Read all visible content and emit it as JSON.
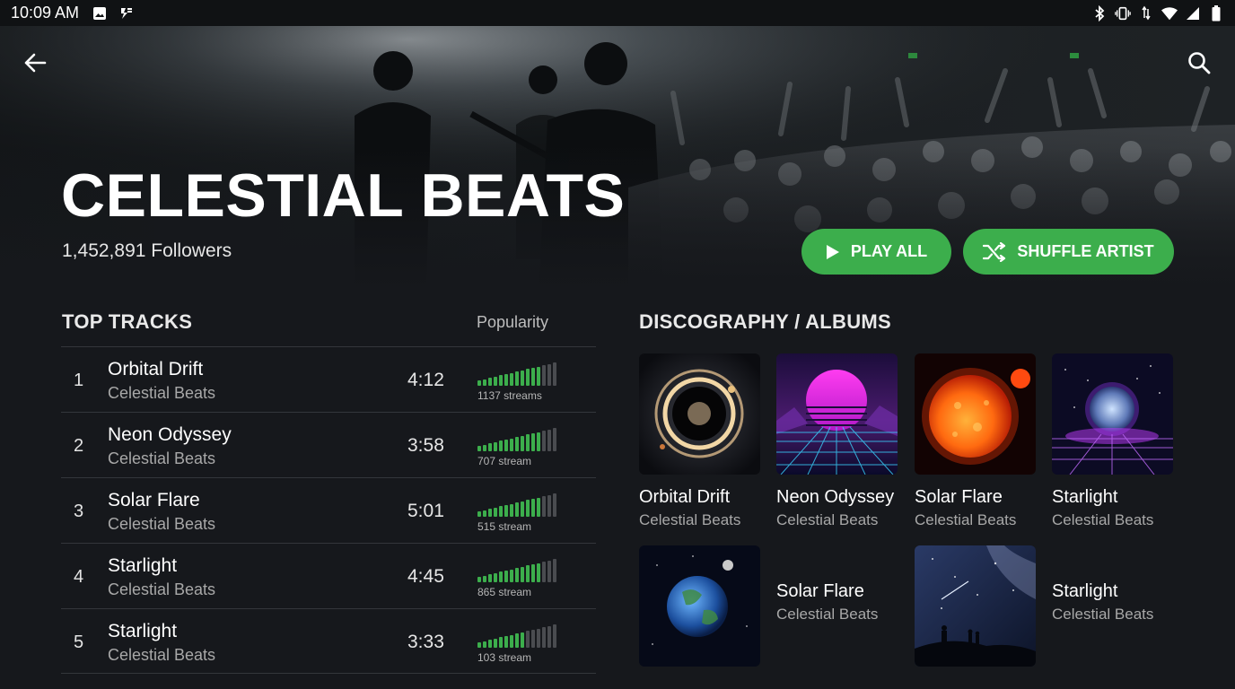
{
  "status_bar": {
    "time": "10:09 AM"
  },
  "artist": {
    "name": "CELESTIAL BEATS",
    "followers": "1,452,891 Followers"
  },
  "actions": {
    "play_all": "PLAY ALL",
    "shuffle": "SHUFFLE ARTIST"
  },
  "top_tracks": {
    "title": "TOP TRACKS",
    "popularity_label": "Popularity",
    "items": [
      {
        "number": "1",
        "title": "Orbital Drift",
        "artist": "Celestial Beats",
        "duration": "4:12",
        "streams": "1137 streams",
        "popularity": 0.8
      },
      {
        "number": "2",
        "title": "Neon Odyssey",
        "artist": "Celestial Beats",
        "duration": "3:58",
        "streams": "707 stream",
        "popularity": 0.8
      },
      {
        "number": "3",
        "title": "Solar Flare",
        "artist": "Celestial Beats",
        "duration": "5:01",
        "streams": "515 stream",
        "popularity": 0.8
      },
      {
        "number": "4",
        "title": "Starlight",
        "artist": "Celestial Beats",
        "duration": "4:45",
        "streams": "865 stream",
        "popularity": 0.8
      },
      {
        "number": "5",
        "title": "Starlight",
        "artist": "Celestial Beats",
        "duration": "3:33",
        "streams": "103 stream",
        "popularity": 0.6
      }
    ]
  },
  "discography": {
    "title": "DISCOGRAPHY / ALBUMS",
    "albums": [
      {
        "title": "Orbital Drift",
        "artist": "Celestial Beats",
        "art": "black-hole-ring"
      },
      {
        "title": "Neon Odyssey",
        "artist": "Celestial Beats",
        "art": "synthwave-sun"
      },
      {
        "title": "Solar Flare",
        "artist": "Celestial Beats",
        "art": "burning-sun"
      },
      {
        "title": "Starlight",
        "artist": "Celestial Beats",
        "art": "glowing-moon-grid"
      },
      {
        "title": "Solar Flare",
        "artist": "Celestial Beats",
        "art": "earth-from-space"
      },
      {
        "title": "Starlight",
        "artist": "Celestial Beats",
        "art": "milky-way-silhouettes"
      }
    ]
  },
  "colors": {
    "accent": "#3cae4c",
    "background": "#16181c",
    "bar_on": "#3cae4c",
    "bar_off": "#4a4c50"
  }
}
